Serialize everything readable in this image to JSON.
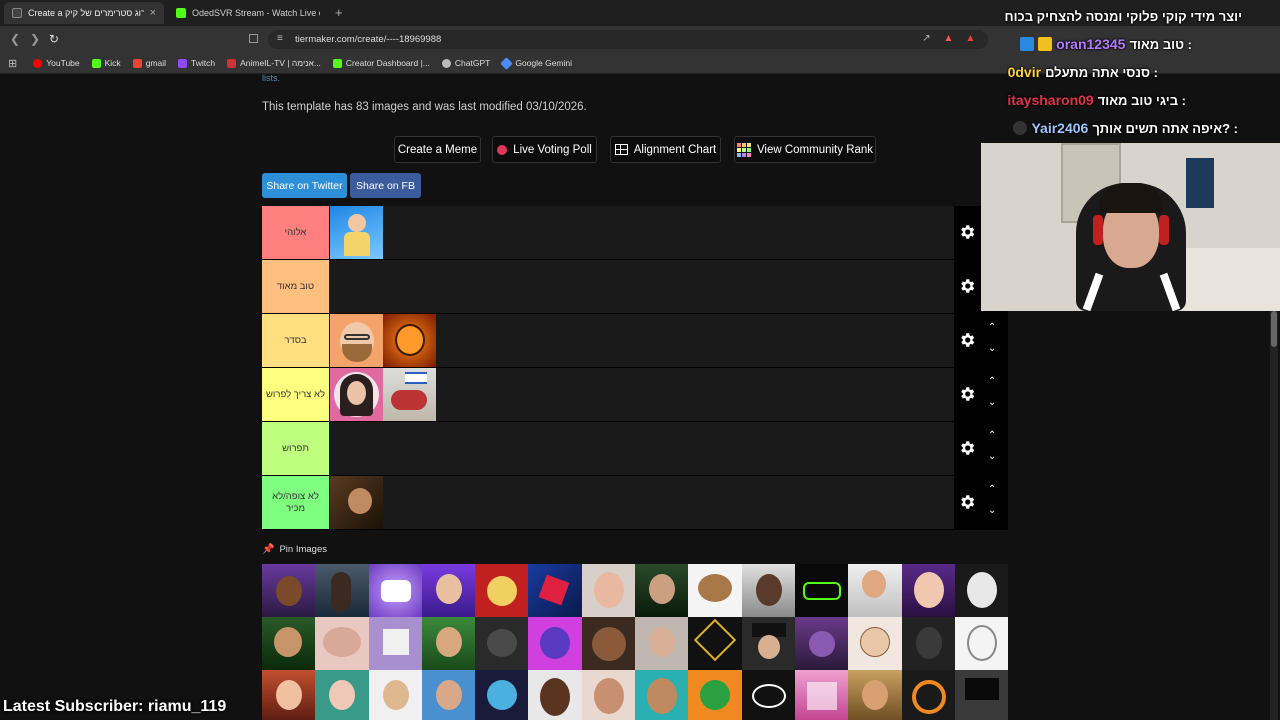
{
  "browser": {
    "tabs": [
      {
        "title": "Create a מיס דירוג סטרימרים של קיק",
        "close": "×",
        "favicon_color": "#444"
      },
      {
        "title": "OdedSVR Stream - Watch Live on Kick",
        "favicon_color": "#53fc18"
      }
    ],
    "new_tab": "+",
    "url": "tiermaker.com/create/----18969988",
    "bookmarks": [
      {
        "label": "YouTube",
        "icon_color": "#ff0000"
      },
      {
        "label": "Kick",
        "icon_color": "#53fc18"
      },
      {
        "label": "gmail",
        "icon_color": "#ea4335"
      },
      {
        "label": "Twitch",
        "icon_color": "#9146ff"
      },
      {
        "label": "AnimeIL-TV | אנימה...",
        "icon_color": "#c33"
      },
      {
        "label": "Creator Dashboard |...",
        "icon_color": "#53fc18"
      },
      {
        "label": "ChatGPT",
        "icon_color": "#bbb"
      },
      {
        "label": "Google Gemini",
        "icon_color": "#4a8cf7"
      }
    ]
  },
  "page": {
    "top_link": "lists.",
    "info_text": "This template has 83 images and was last modified 03/10/2026.",
    "buttons": {
      "meme": "Create a Meme",
      "poll": "Live Voting Poll",
      "alignment": "Alignment Chart",
      "rank": "View Community Rank"
    },
    "share": {
      "twitter": "Share on Twitter",
      "fb": "Share on FB"
    },
    "tiers": [
      {
        "label": "אלוהי",
        "color": "#ff7f7f",
        "count": 1,
        "arrows": false
      },
      {
        "label": "טוב מאוד",
        "color": "#ffbf7f",
        "count": 0,
        "arrows": false
      },
      {
        "label": "בסדר",
        "color": "#ffdf7f",
        "count": 2,
        "arrows": true
      },
      {
        "label": "לא צריך לפרוש",
        "color": "#ffff7f",
        "count": 2,
        "arrows": true
      },
      {
        "label": "תפרוש",
        "color": "#bfff7f",
        "count": 0,
        "arrows": true
      },
      {
        "label": "לא צופה/לא מכיר",
        "color": "#7fff7f",
        "count": 1,
        "arrows": true
      }
    ],
    "pin_label": "Pin Images"
  },
  "overlay": {
    "chat": [
      {
        "text": "יוצר מידי קוקי פלוקי ומנסה להצחיק בכוח"
      },
      {
        "user": "oran12345",
        "user_color": "#b27cff",
        "text": "טוב מאוד :"
      },
      {
        "user": "0dvir",
        "user_color": "#ffd23a",
        "text": "סנסי אתה מתעלם :"
      },
      {
        "user": "itaysharon09",
        "user_color": "#e2334d",
        "text": "ביגי טוב מאוד :"
      },
      {
        "user": "Yair2406",
        "user_color": "#9ec7ff",
        "text": "איפה אתה תשים אותך? :"
      }
    ],
    "latest_subscriber": "Latest Subscriber: riamu_119"
  }
}
